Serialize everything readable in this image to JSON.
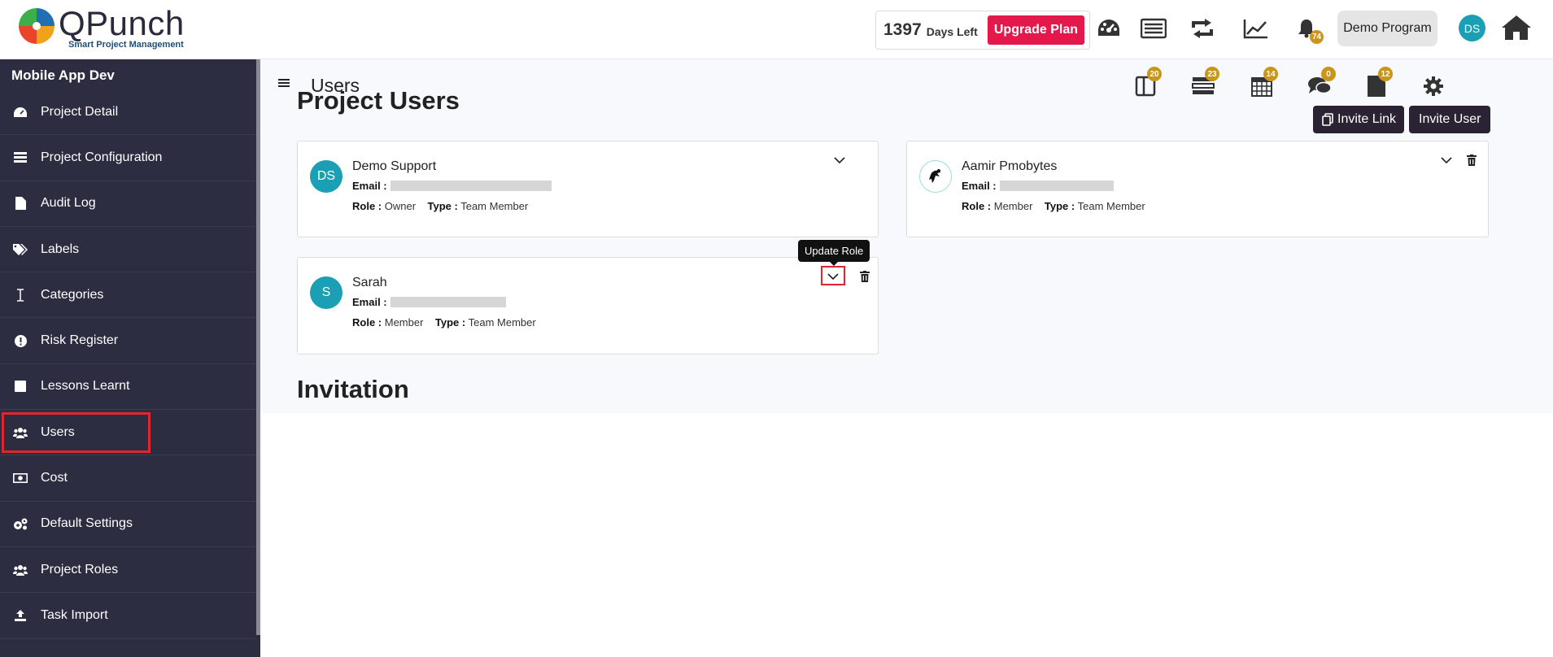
{
  "brand": {
    "name": "QPunch",
    "tagline": "Smart Project Management"
  },
  "header": {
    "days_number": "1397",
    "days_label": "Days Left",
    "upgrade_label": "Upgrade Plan",
    "notification_count": "74",
    "program_label": "Demo Program",
    "avatar_initials": "DS"
  },
  "sidebar": {
    "project_name": "Mobile App Dev",
    "items": [
      {
        "label": "Project Detail",
        "icon": "dashboard-icon"
      },
      {
        "label": "Project Configuration",
        "icon": "config-icon"
      },
      {
        "label": "Audit Log",
        "icon": "file-icon"
      },
      {
        "label": "Labels",
        "icon": "tags-icon"
      },
      {
        "label": "Categories",
        "icon": "text-cursor-icon"
      },
      {
        "label": "Risk Register",
        "icon": "exclamation-icon"
      },
      {
        "label": "Lessons Learnt",
        "icon": "square-icon"
      },
      {
        "label": "Users",
        "icon": "users-icon"
      },
      {
        "label": "Cost",
        "icon": "money-icon"
      },
      {
        "label": "Default Settings",
        "icon": "cogs-icon"
      },
      {
        "label": "Project Roles",
        "icon": "users-icon"
      },
      {
        "label": "Task Import",
        "icon": "upload-icon"
      }
    ]
  },
  "main": {
    "page_title": "Users",
    "sub_badges": {
      "tasks": "20",
      "list": "23",
      "calendar": "14",
      "comments": "0",
      "files": "12"
    },
    "section_users": "Project Users",
    "invite_link_label": "Invite Link",
    "invite_user_label": "Invite User",
    "section_invitation": "Invitation",
    "tooltip_update_role": "Update Role",
    "labels": {
      "email": "Email :",
      "role": "Role :",
      "type": "Type :"
    },
    "users": [
      {
        "name": "Demo Support",
        "initials": "DS",
        "role": "Owner",
        "type": "Team Member"
      },
      {
        "name": "Aamir Pmobytes",
        "initials": "",
        "role": "Member",
        "type": "Team Member"
      },
      {
        "name": "Sarah",
        "initials": "S",
        "role": "Member",
        "type": "Team Member"
      }
    ]
  }
}
